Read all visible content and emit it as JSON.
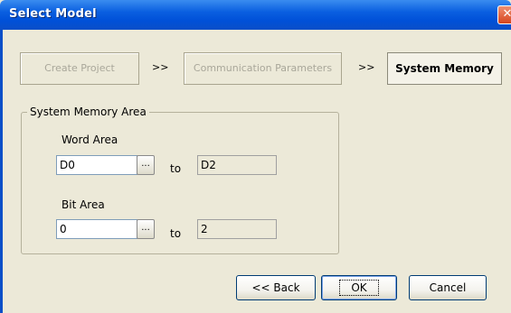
{
  "window": {
    "title": "Select Model"
  },
  "wizard": {
    "steps": [
      {
        "label": "Create Project",
        "state": "inactive"
      },
      {
        "label": "Communication Parameters",
        "state": "inactive"
      },
      {
        "label": "System Memory",
        "state": "active"
      }
    ],
    "separator": ">>"
  },
  "system_memory": {
    "group_title": "System Memory Area",
    "word_area": {
      "label": "Word Area",
      "from_value": "D0",
      "to_label": "to",
      "to_value": "D2",
      "browse_label": "..."
    },
    "bit_area": {
      "label": "Bit Area",
      "from_value": "0",
      "to_label": "to",
      "to_value": "2",
      "browse_label": "..."
    }
  },
  "buttons": {
    "back": "<< Back",
    "ok": "OK",
    "cancel": "Cancel"
  },
  "colors": {
    "titlebar": "#0a5fe0",
    "dialog_bg": "#ece9d8",
    "input_border": "#7f9db9"
  }
}
